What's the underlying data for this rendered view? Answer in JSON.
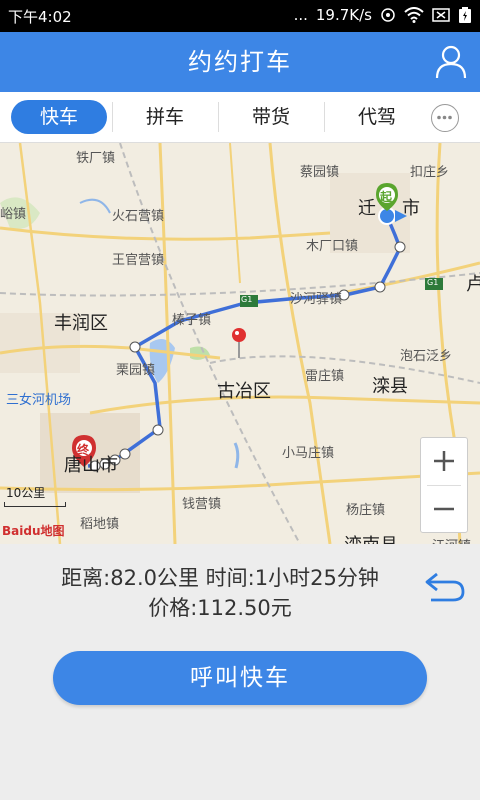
{
  "status": {
    "time": "下午4:02",
    "speed": "19.7K/s",
    "dots": "..."
  },
  "app": {
    "title": "约约打车"
  },
  "tabs": [
    {
      "label": "快车",
      "active": true
    },
    {
      "label": "拼车",
      "active": false
    },
    {
      "label": "带货",
      "active": false
    },
    {
      "label": "代驾",
      "active": false
    }
  ],
  "map": {
    "labels": {
      "tiechang": "铁厂镇",
      "caiyuan": "蔡园镇",
      "kouzhuang": "扣庄乡",
      "qian": "迁",
      "shi": "市",
      "lingzhen": "峪镇",
      "huoshiying": "火石营镇",
      "wangguanying": "王官营镇",
      "muchangkou": "木厂口镇",
      "fengrun": "丰润区",
      "shahezhan": "沙河驿镇",
      "bangzi": "榛子镇",
      "paoshi": "泡石泛乡",
      "lizhuang": "栗园镇",
      "guye": "古冶区",
      "leizhuang": "雷庄镇",
      "luanxian": "滦县",
      "airport": "三女河机场",
      "xiaomazhuang": "小马庄镇",
      "tangshan": "唐山市",
      "qianying": "钱营镇",
      "daodi": "稻地镇",
      "yanzhuang": "杨庄镇",
      "luannan": "滦南县",
      "jianghe": "江河镇",
      "g1": "G1",
      "chu": "卢"
    },
    "start_label": "起",
    "end_label": "终",
    "scale": "10公里",
    "logo": "Baidu地图"
  },
  "trip": {
    "line1": "距离:82.0公里  时间:1小时25分钟",
    "line2": "价格:112.50元"
  },
  "call_button": "呼叫快车",
  "colors": {
    "primary": "#3d86e6",
    "route": "#3f6fd8",
    "start": "#5aa52e",
    "end": "#d03030"
  }
}
